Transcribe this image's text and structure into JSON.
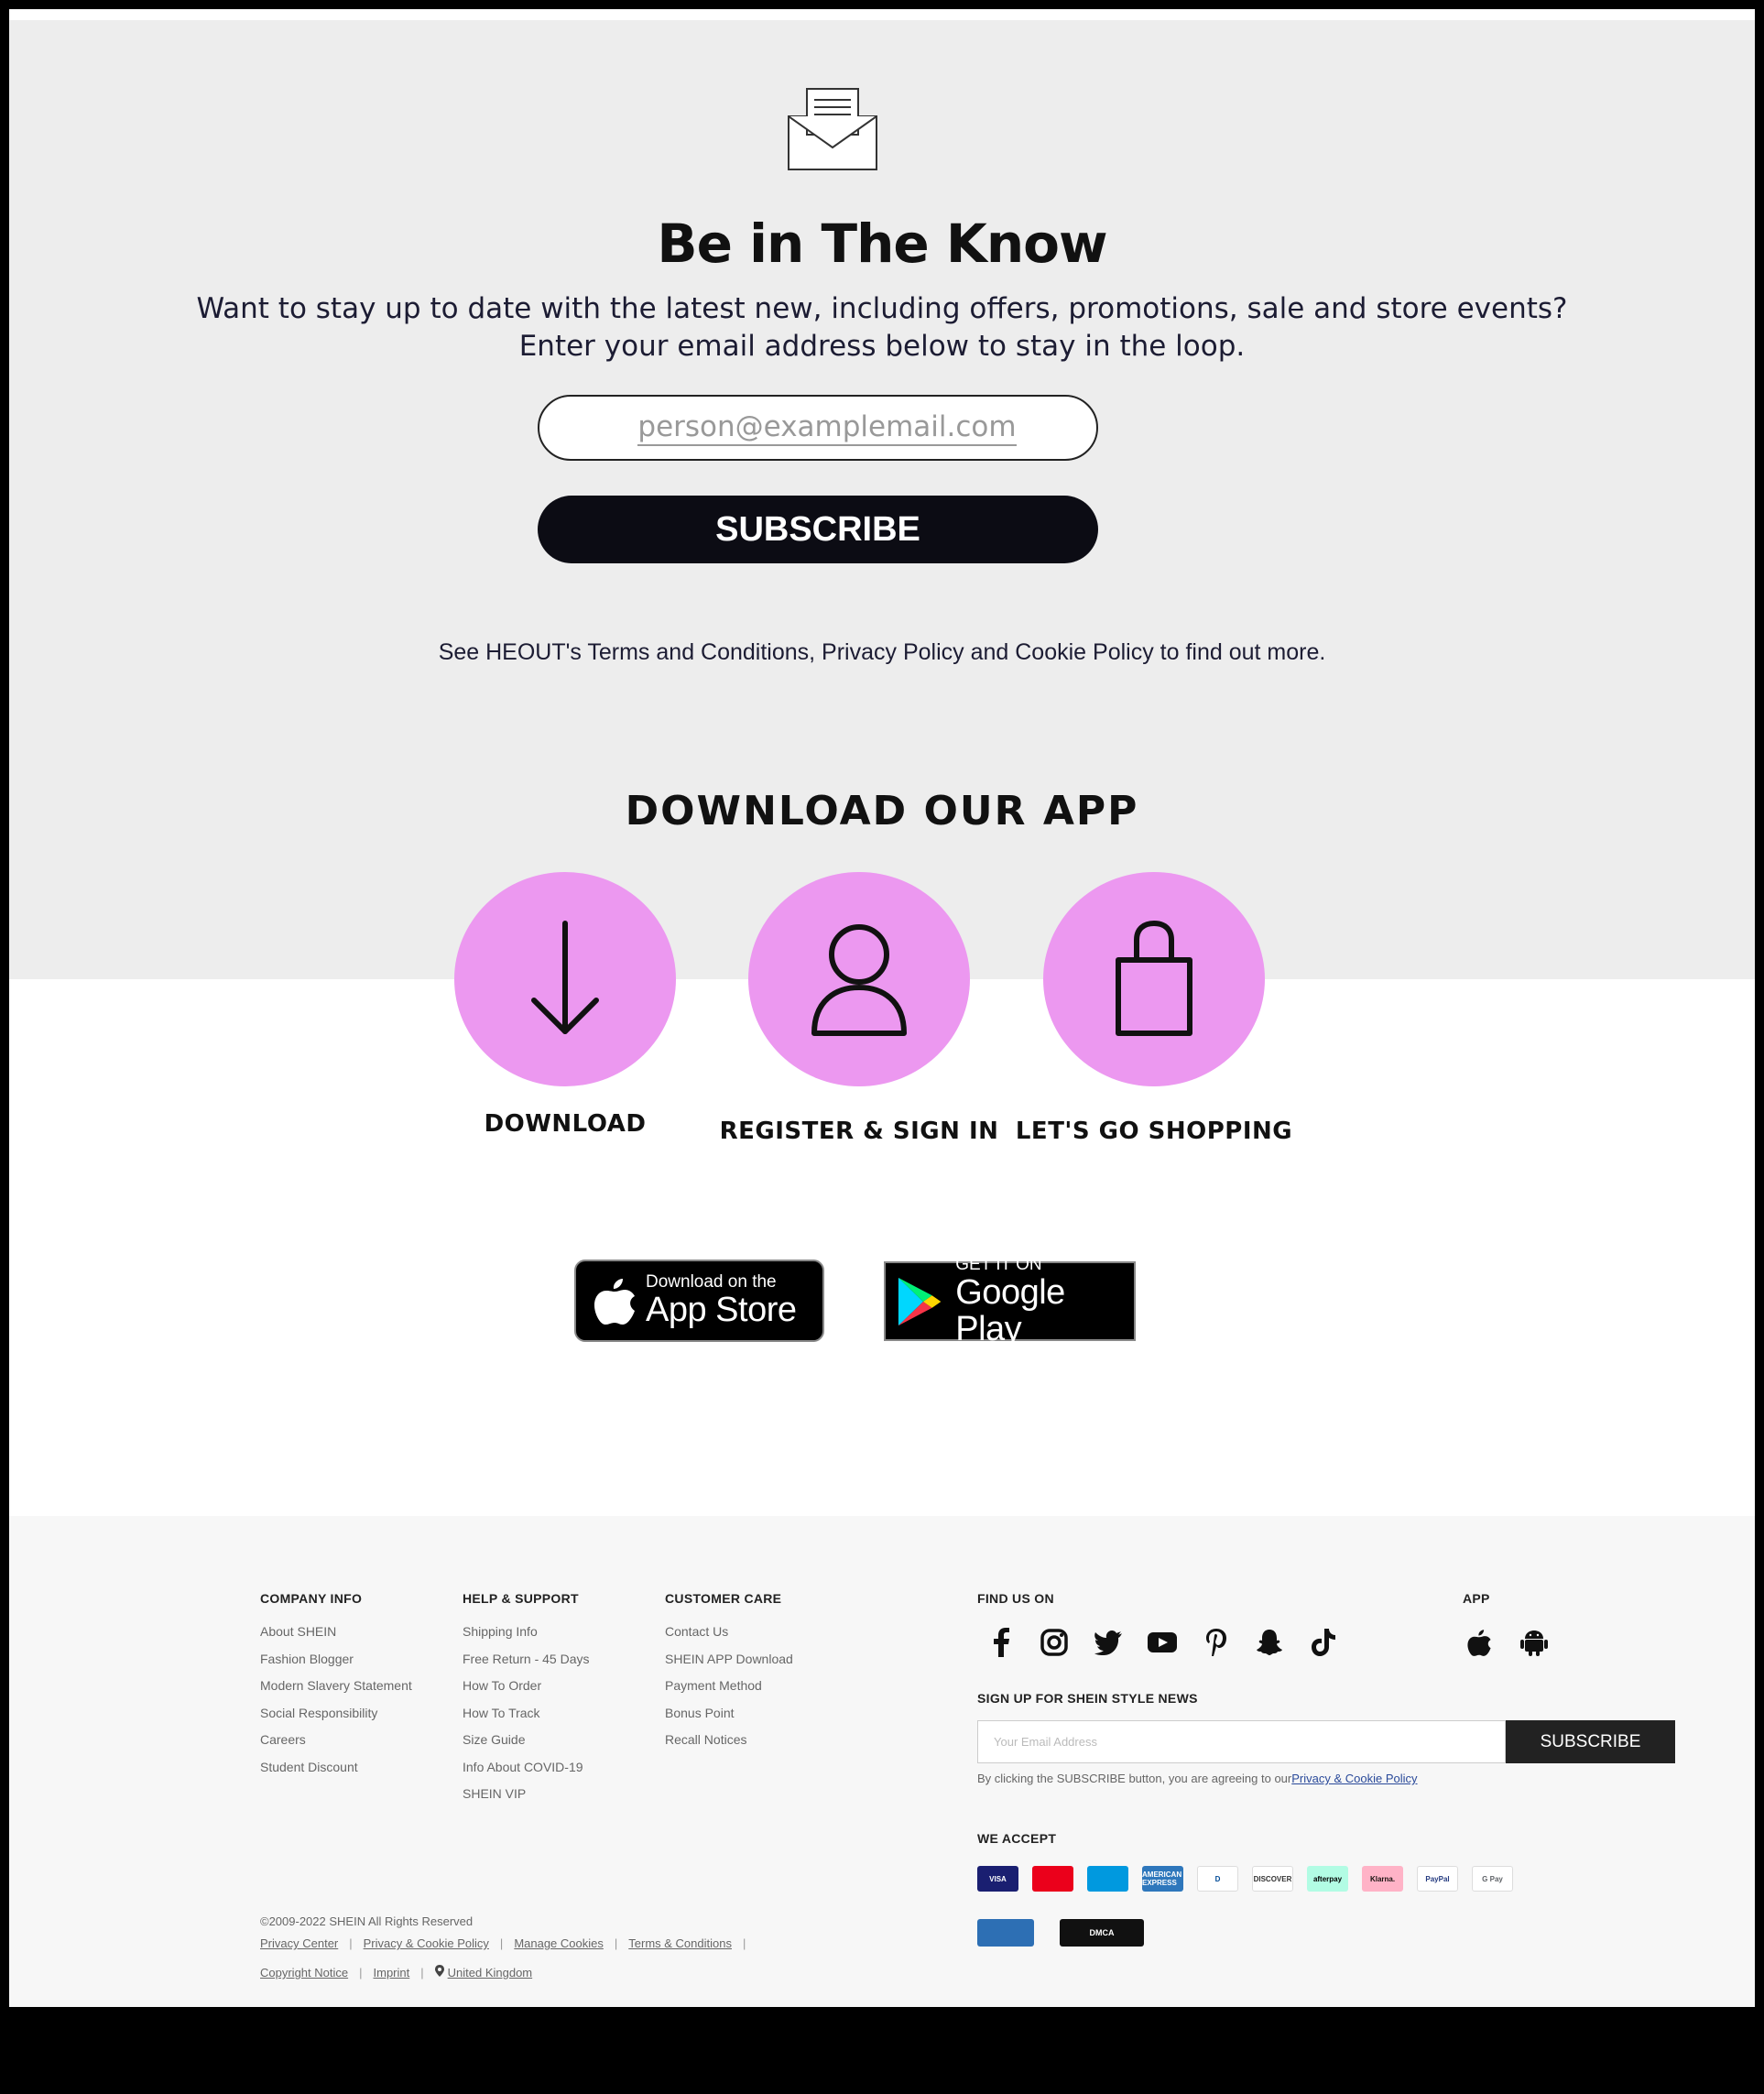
{
  "newsletter": {
    "icon": "envelope-icon",
    "title": "Be in The Know",
    "subtitle_line1": "Want to stay up to date with the latest new, including offers, promotions, sale and store events?",
    "subtitle_line2": "Enter your email address below to stay in the loop.",
    "email_placeholder": "person@examplemail.com",
    "subscribe_label": "SUBSCRIBE",
    "terms_text": "See HEOUT's Terms and Conditions, Privacy Policy and Cookie Policy to find out more."
  },
  "app_section": {
    "title": "DOWNLOAD OUR APP",
    "steps": [
      {
        "label": "DOWNLOAD",
        "icon": "arrow-down-icon"
      },
      {
        "label": "REGISTER & SIGN IN",
        "icon": "user-icon"
      },
      {
        "label": "LET'S GO SHOPPING",
        "icon": "shopping-bag-icon"
      }
    ],
    "app_store": {
      "small": "Download on the",
      "big": "App Store"
    },
    "google_play": {
      "small": "GET IT ON",
      "big": "Google Play"
    }
  },
  "footer": {
    "company": {
      "heading": "COMPANY INFO",
      "links": [
        "About SHEIN",
        "Fashion Blogger",
        "Modern Slavery Statement",
        "Social Responsibility",
        "Careers",
        "Student Discount"
      ]
    },
    "help": {
      "heading": "HELP & SUPPORT",
      "links": [
        "Shipping Info",
        "Free Return - 45 Days",
        "How To Order",
        "How To Track",
        "Size Guide",
        "Info About COVID-19",
        "SHEIN VIP"
      ]
    },
    "care": {
      "heading": "CUSTOMER CARE",
      "links": [
        "Contact Us",
        "SHEIN APP Download",
        "Payment Method",
        "Bonus Point",
        "Recall Notices"
      ]
    },
    "find_us": {
      "heading": "FIND US ON",
      "icons": [
        "facebook-icon",
        "instagram-icon",
        "twitter-icon",
        "youtube-icon",
        "pinterest-icon",
        "snapchat-icon",
        "tiktok-icon"
      ]
    },
    "app": {
      "heading": "APP",
      "icons": [
        "apple-icon",
        "android-icon"
      ]
    },
    "signup": {
      "heading": "SIGN UP FOR SHEIN STYLE NEWS",
      "placeholder": "Your Email Address",
      "button": "SUBSCRIBE",
      "agree_text": "By clicking the SUBSCRIBE button, you are agreeing to our",
      "agree_link": "Privacy & Cookie Policy"
    },
    "we_accept": {
      "heading": "WE ACCEPT",
      "methods": [
        {
          "label": "VISA",
          "color": "#1a1f71",
          "text_color": "#ffffff"
        },
        {
          "label": "",
          "color": "#eb001b",
          "text_color": "#ffffff"
        },
        {
          "label": "",
          "color": "#0099df",
          "text_color": "#ffffff"
        },
        {
          "label": "AMERICAN EXPRESS",
          "color": "#2e77bc",
          "text_color": "#ffffff"
        },
        {
          "label": "D",
          "color": "#ffffff",
          "text_color": "#004a97"
        },
        {
          "label": "DISCOVER",
          "color": "#ffffff",
          "text_color": "#333333"
        },
        {
          "label": "afterpay",
          "color": "#b2fce4",
          "text_color": "#000000"
        },
        {
          "label": "Klarna.",
          "color": "#ffb3c7",
          "text_color": "#17120f"
        },
        {
          "label": "PayPal",
          "color": "#ffffff",
          "text_color": "#253b80"
        },
        {
          "label": "G Pay",
          "color": "#ffffff",
          "text_color": "#5f6368"
        }
      ],
      "seals": [
        {
          "label": "",
          "color": "#2d6fb4",
          "text_color": "#ffffff"
        },
        {
          "label": "DMCA",
          "color": "#111111",
          "text_color": "#ffffff"
        }
      ]
    },
    "copyright": "©2009-2022 SHEIN All Rights Reserved",
    "legal_row1": [
      "Privacy Center",
      "Privacy & Cookie Policy",
      "Manage Cookies",
      "Terms & Conditions"
    ],
    "legal_row2": [
      "Copyright Notice",
      "Imprint"
    ],
    "region": "United Kingdom"
  }
}
